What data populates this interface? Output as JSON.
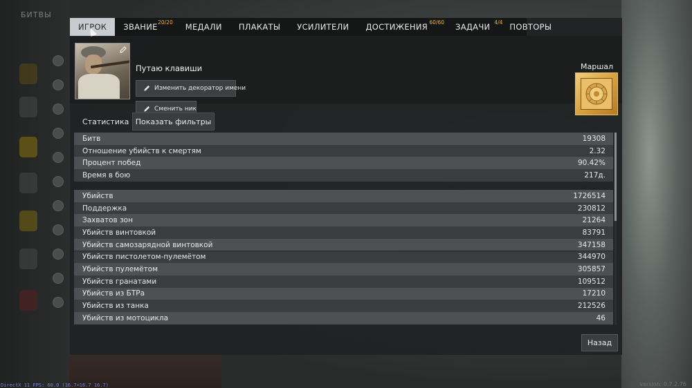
{
  "background": {
    "left_tab": "БИТВЫ",
    "fps": "DirectX 11 FPS: 60.0 (16.7<16.7 16.7)",
    "version": "version: 0.7.2.76"
  },
  "tabs": [
    {
      "label": "ИГРОК",
      "badge": ""
    },
    {
      "label": "ЗВАНИЕ",
      "badge": "20/20"
    },
    {
      "label": "МЕДАЛИ",
      "badge": ""
    },
    {
      "label": "ПЛАКАТЫ",
      "badge": ""
    },
    {
      "label": "УСИЛИТЕЛИ",
      "badge": ""
    },
    {
      "label": "ДОСТИЖЕНИЯ",
      "badge": "60/60"
    },
    {
      "label": "ЗАДАЧИ",
      "badge": "4/4"
    },
    {
      "label": "ПОВТОРЫ",
      "badge": ""
    }
  ],
  "profile": {
    "nickname": "Путаю клавиши",
    "change_decorator_label": "Изменить декоратор имени",
    "change_nick_label": "Сменить ник",
    "rank_name": "Маршал"
  },
  "stats": {
    "title": "Статистика",
    "filter_button": "Показать фильтры",
    "rows": [
      {
        "label": "Битв",
        "value": "19308"
      },
      {
        "label": "Отношение убийств к смертям",
        "value": "2.32"
      },
      {
        "label": "Процент побед",
        "value": "90.42%"
      },
      {
        "label": "Время в бою",
        "value": "217д."
      },
      {
        "label": "Убийств",
        "value": "1726514"
      },
      {
        "label": "Поддержка",
        "value": "230812"
      },
      {
        "label": "Захватов зон",
        "value": "21264"
      },
      {
        "label": "Убийств винтовкой",
        "value": "83791"
      },
      {
        "label": "Убийств самозарядной винтовкой",
        "value": "347158"
      },
      {
        "label": "Убийств пистолетом-пулемётом",
        "value": "344970"
      },
      {
        "label": "Убийств пулемётом",
        "value": "305857"
      },
      {
        "label": "Убийств гранатами",
        "value": "109512"
      },
      {
        "label": "Убийств из БТРа",
        "value": "17210"
      },
      {
        "label": "Убийств из танка",
        "value": "212526"
      },
      {
        "label": "Убийств из мотоцикла",
        "value": "46"
      }
    ]
  },
  "footer": {
    "back_label": "Назад"
  },
  "colors": {
    "accent_badge": "#f1b520",
    "active_tab_bg": "#c9ccce",
    "rank_gold": "#d9a13e"
  }
}
